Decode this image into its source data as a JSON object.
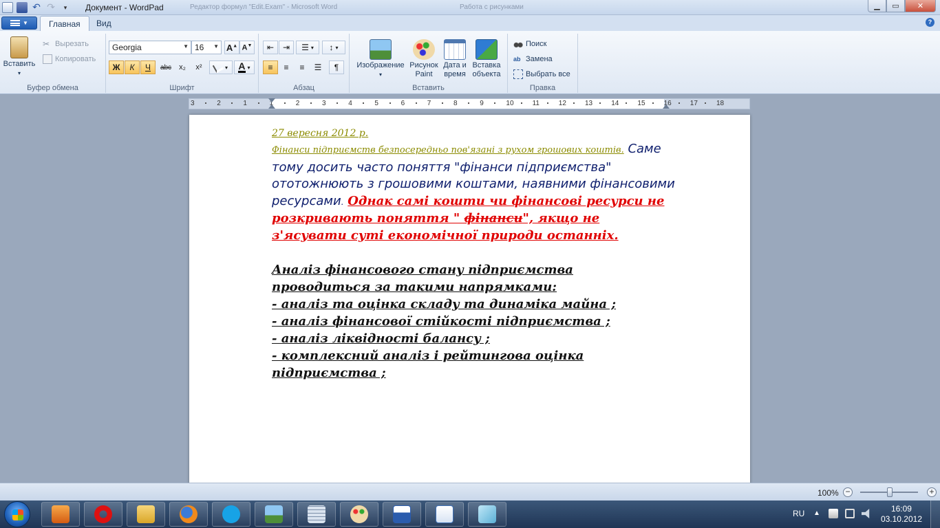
{
  "window": {
    "title": "Документ - WordPad",
    "ghost_titles": [
      "Редактор формул \"Edit.Exam\" - Microsoft Word",
      "Работа с рисунками"
    ]
  },
  "tabs": [
    {
      "label": "Главная",
      "active": true
    },
    {
      "label": "Вид",
      "active": false
    }
  ],
  "clipboard": {
    "paste_label": "Вставить",
    "cut_label": "Вырезать",
    "copy_label": "Копировать",
    "group_label": "Буфер обмена"
  },
  "font": {
    "family_value": "Georgia",
    "size_value": "16",
    "bold": "Ж",
    "italic": "К",
    "underline": "Ч",
    "strike": "abc",
    "sub": "x₂",
    "sup": "x²",
    "color_glyph": "A",
    "group_label": "Шрифт"
  },
  "paragraph": {
    "group_label": "Абзац"
  },
  "insert": {
    "image_label": "Изображение",
    "paint_label_1": "Рисунок",
    "paint_label_2": "Paint",
    "datetime_label_1": "Дата и",
    "datetime_label_2": "время",
    "object_label_1": "Вставка",
    "object_label_2": "объекта",
    "group_label": "Вставить"
  },
  "editing": {
    "find_label": "Поиск",
    "replace_label": "Замена",
    "select_all_label": "Выбрать все",
    "group_label": "Правка"
  },
  "ruler": {
    "labels": [
      "3",
      "2",
      "1",
      "1",
      "2",
      "3",
      "4",
      "5",
      "6",
      "7",
      "8",
      "9",
      "10",
      "11",
      "12",
      "13",
      "14",
      "15",
      "16",
      "17",
      "18"
    ]
  },
  "document": {
    "date_line": "27 вересня 2012 р.",
    "olive_sentence": "Фінанси підприємств безпосередньо пов'язані з рухом грошових коштів",
    "blue_text": "Саме тому досить часто поняття \"фінанси підприємства\" ототожнюють з грошовими коштами, наявними фінансовими ресурсами",
    "red_text_1": "Однак самі кошти чи фінансові ресурси не розкривають поняття \" ",
    "red_strike": "фінанси",
    "red_text_2": "\", якщо не з'ясувати суті економічної природи останніх.",
    "analysis_lines": [
      "Аналіз фінансового стану підприємства",
      "проводиться за такими напрямками:",
      "- аналіз та оцінка складу та динаміка майна ;",
      "- аналіз фінансової стійкості підприємства ;",
      "- аналіз ліквідності балансу ;",
      "- комплексний аналіз і рейтингова оцінка",
      "підприємства ;"
    ]
  },
  "status": {
    "zoom": "100%",
    "minus": "−",
    "plus": "+",
    "zoom_percent": 100
  },
  "taskbar": {
    "lang": "RU",
    "time": "16:09",
    "date": "03.10.2012"
  },
  "colors": {
    "olive": "#8b8b00",
    "navy": "#10206e",
    "red": "#e00000"
  }
}
